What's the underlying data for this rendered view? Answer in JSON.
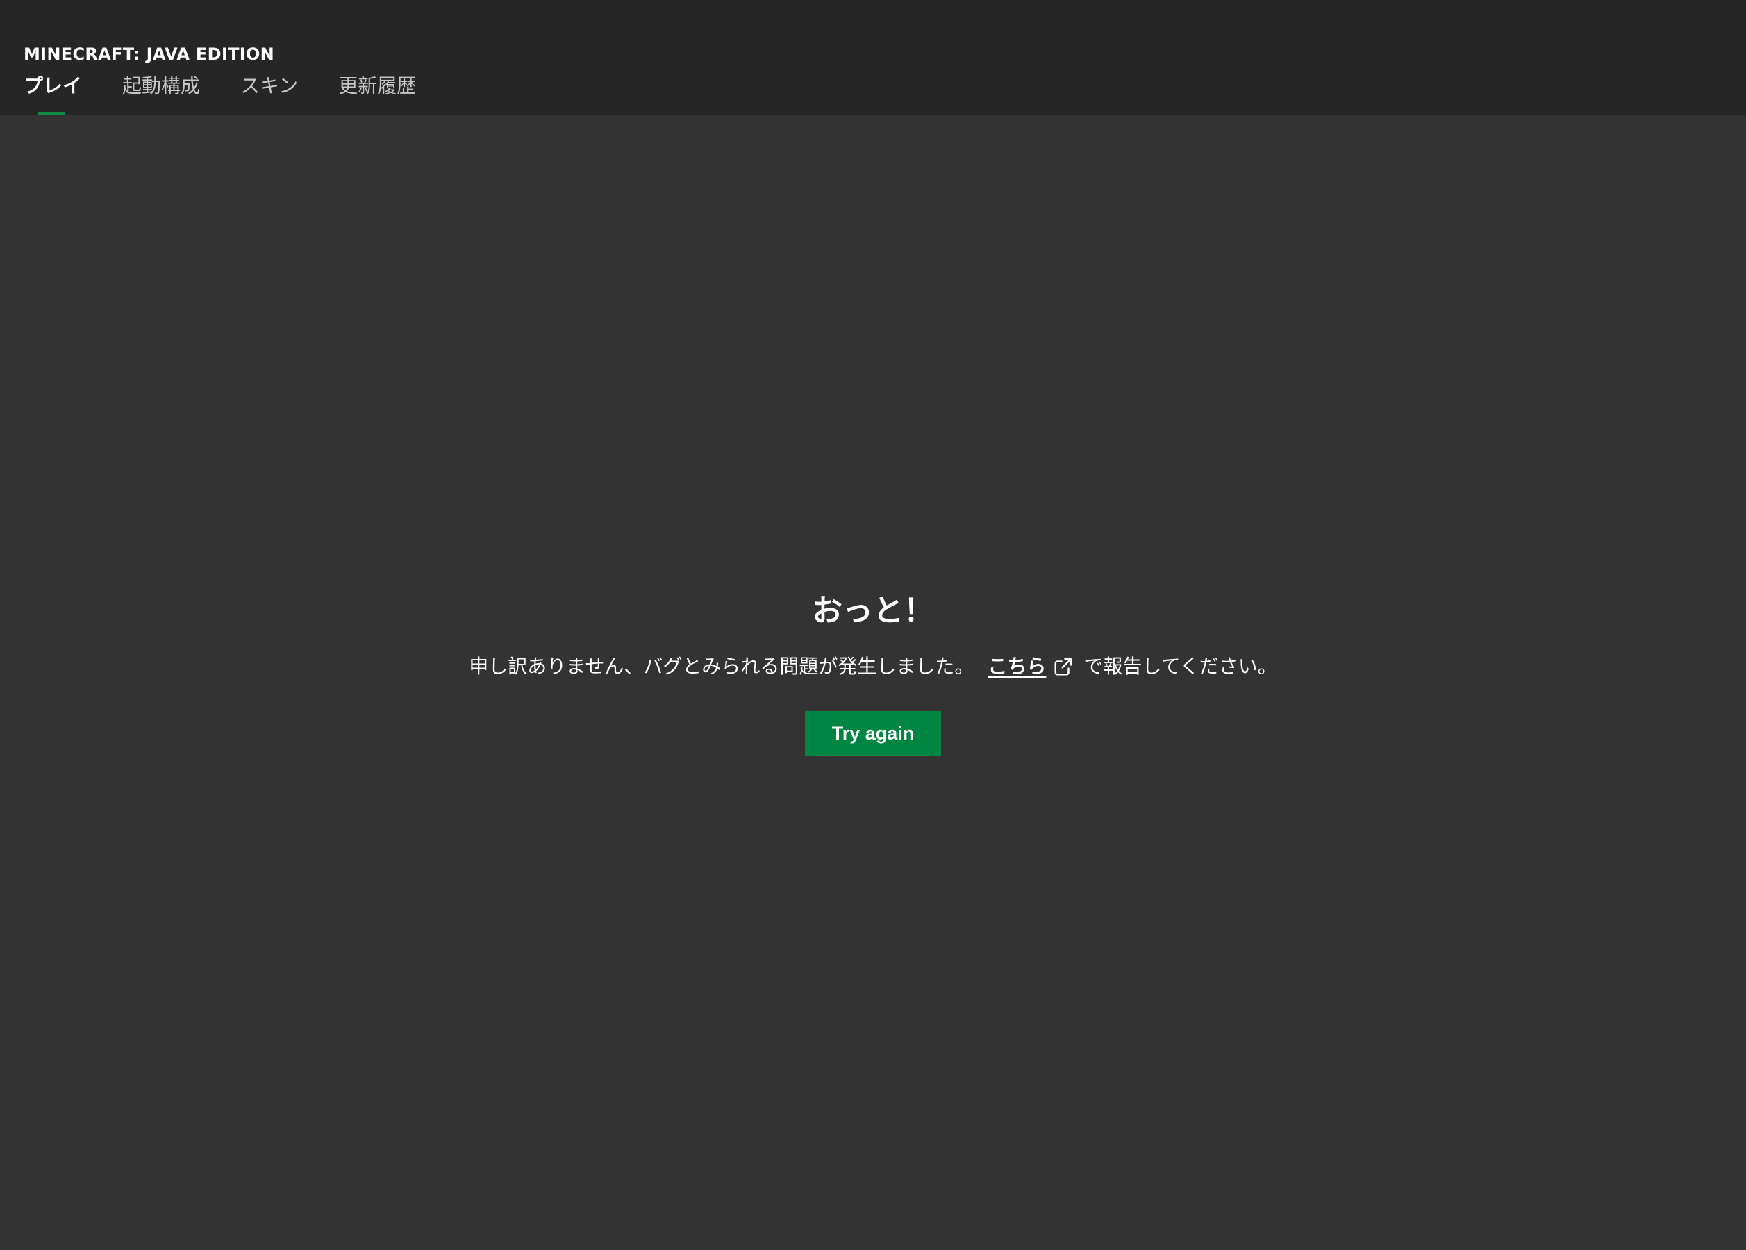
{
  "header": {
    "product_title": "MINECRAFT: JAVA EDITION",
    "tabs": [
      {
        "label": "プレイ",
        "active": true
      },
      {
        "label": "起動構成",
        "active": false
      },
      {
        "label": "スキン",
        "active": false
      },
      {
        "label": "更新履歴",
        "active": false
      }
    ]
  },
  "error": {
    "title": "おっと！",
    "message_before": "申し訳ありません、バグとみられる問題が発生しました。",
    "link_label": "こちら",
    "link_icon": "external-link-icon",
    "message_after": "で報告してください。",
    "button_label": "Try again"
  },
  "colors": {
    "background": "#333333",
    "header_background": "#262626",
    "accent": "#008542",
    "text": "#ffffff",
    "inactive_tab": "#c7c7c7"
  }
}
